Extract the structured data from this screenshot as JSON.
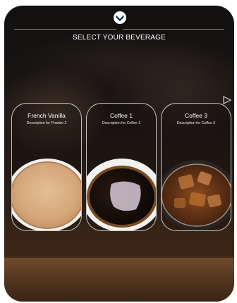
{
  "screen": {
    "title": "SELECT YOUR BEVERAGE"
  },
  "logo": {
    "icon": "chevron-down-icon"
  },
  "navigation": {
    "next_icon": "triangle-right-icon"
  },
  "beverages": [
    {
      "name": "French Vanilla",
      "description": "Description for Powder 2",
      "image": "latte-top-view"
    },
    {
      "name": "Coffee 1",
      "description": "Description for Coffee 1",
      "image": "black-coffee-top-view"
    },
    {
      "name": "Coffee 3",
      "description": "Description for Coffee 3",
      "image": "iced-coffee-top-view"
    }
  ],
  "colors": {
    "text": "#ffffff",
    "card_border": "#ebebeb",
    "latte": "#d8b08a",
    "black_coffee": "#140c08",
    "iced_coffee": "#5a2f15"
  }
}
